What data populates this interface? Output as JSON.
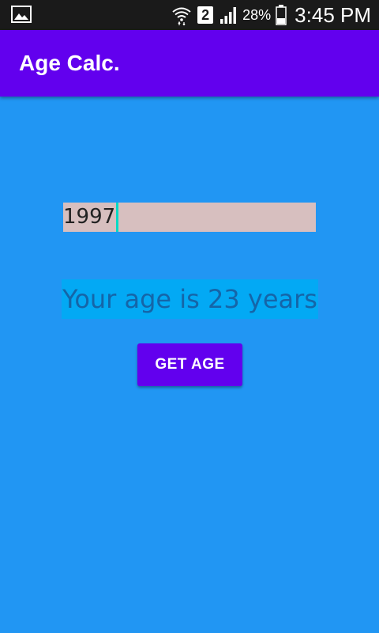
{
  "status_bar": {
    "left_icon": "image-icon",
    "sim_number": "2",
    "battery_percent": "28%",
    "time": "3:45 PM"
  },
  "app_bar": {
    "title": "Age Calc."
  },
  "form": {
    "year_value": "1997",
    "result_text": "Your age is 23 years",
    "button_label": "GET AGE"
  },
  "colors": {
    "background": "#2196F3",
    "app_bar": "#6200EE",
    "input_background": "#D7BFBF",
    "result_background": "#03A9F4",
    "result_text": "#1565A8",
    "cursor": "#03DAC5"
  }
}
